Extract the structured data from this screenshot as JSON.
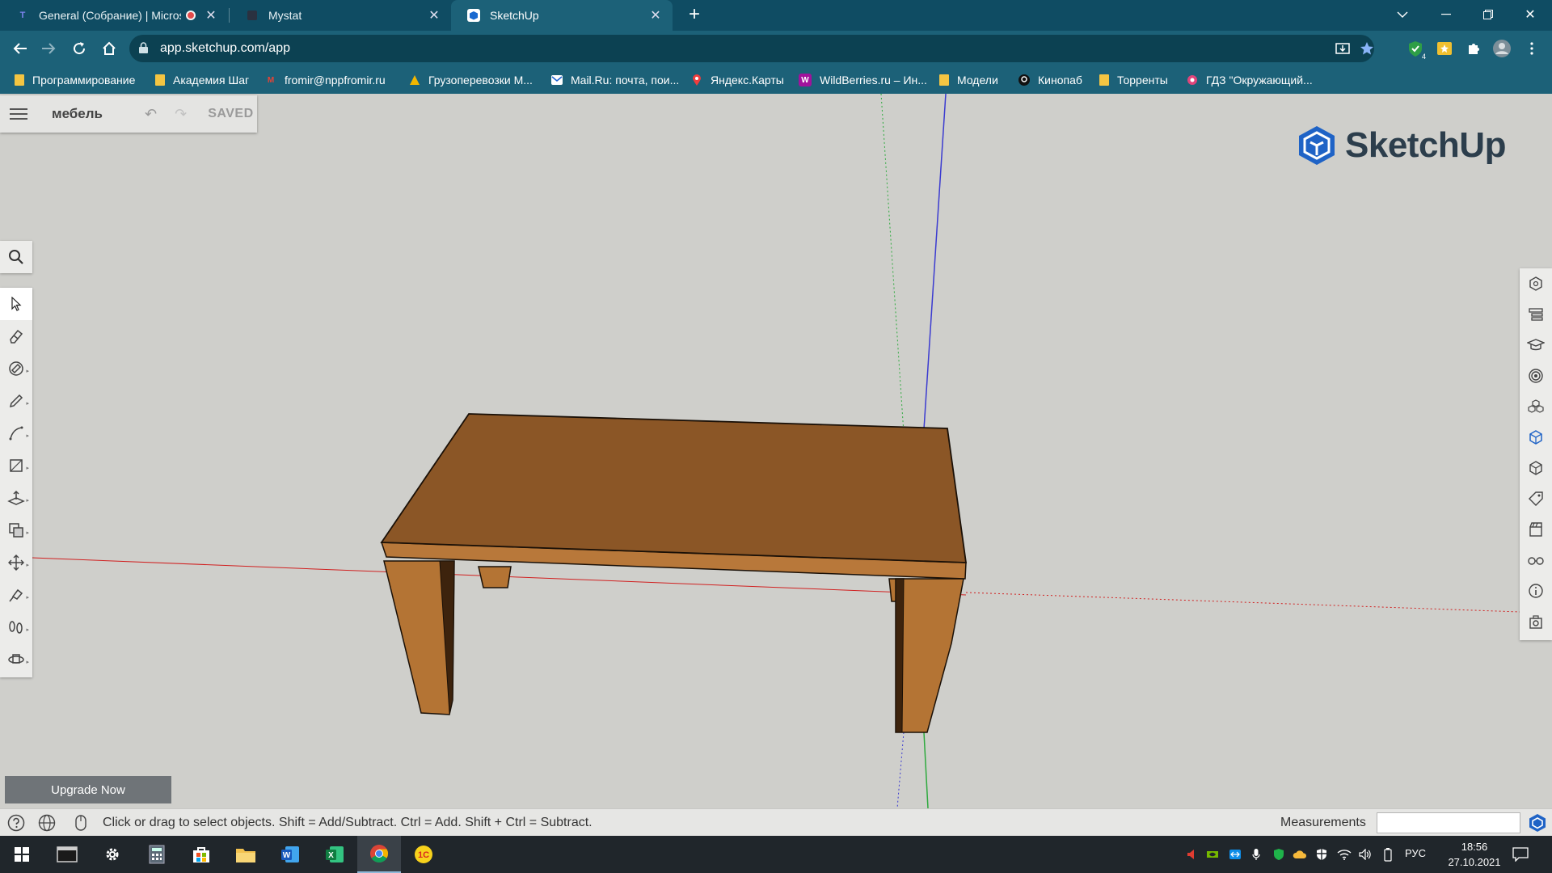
{
  "browser": {
    "tabs": [
      {
        "title": "General (Собрание) | Micros",
        "icon": "teams-icon",
        "active": false
      },
      {
        "title": "Mystat",
        "icon": "mystat-icon",
        "active": false
      },
      {
        "title": "SketchUp",
        "icon": "sketchup-icon",
        "active": true
      }
    ],
    "new_tab": "+",
    "url": "app.sketchup.com/app",
    "bookmarks": [
      {
        "label": "Программирование",
        "icon": "folder-icon"
      },
      {
        "label": "Академия Шаг",
        "icon": "folder-icon"
      },
      {
        "label": "fromir@nppfromir.ru",
        "icon": "gmail-icon"
      },
      {
        "label": "Грузоперевозки М...",
        "icon": "truck-logo-icon"
      },
      {
        "label": "Mail.Ru: почта, пои...",
        "icon": "mail-icon"
      },
      {
        "label": "Яндекс.Карты",
        "icon": "map-pin-icon"
      },
      {
        "label": "WildBerries.ru – Ин...",
        "icon": "wildberries-icon"
      },
      {
        "label": "Модели",
        "icon": "folder-icon"
      },
      {
        "label": "Кинопаб",
        "icon": "kinopub-icon"
      },
      {
        "label": "Торренты",
        "icon": "folder-icon"
      },
      {
        "label": "ГДЗ \"Окружающий...",
        "icon": "gdz-icon"
      }
    ],
    "extension_badge": "4"
  },
  "app": {
    "file_name": "мебель",
    "save_status": "SAVED",
    "brand": "SketchUp",
    "upgrade_label": "Upgrade Now",
    "status_hint": "Click or drag to select objects. Shift = Add/Subtract. Ctrl = Add. Shift + Ctrl = Subtract.",
    "measurements_label": "Measurements",
    "measurements_value": "",
    "selected_tool": "select",
    "left_tools": [
      "select-icon",
      "eraser-icon",
      "paint-bucket-icon",
      "pencil-icon",
      "arc-icon",
      "rectangle-icon",
      "push-pull-icon",
      "offset-icon",
      "move-icon",
      "tape-measure-icon",
      "walk-icon",
      "orbit-icon"
    ],
    "right_panels": [
      "entity-info-icon",
      "outliner-icon",
      "instructor-icon",
      "materials-icon",
      "components-icon",
      "styles-icon",
      "scenes-3d-icon",
      "tags-icon",
      "scenes-icon",
      "display-icon",
      "model-info-icon",
      "export-icon"
    ]
  },
  "taskbar": {
    "language": "РУС",
    "time": "18:56",
    "date": "27.10.2021",
    "apps": [
      "windows-start-icon",
      "terminal-icon",
      "settings-icon",
      "calculator-icon",
      "store-icon",
      "file-explorer-icon",
      "word-icon",
      "excel-icon",
      "chrome-icon",
      "1c-icon"
    ],
    "active_app": "chrome-icon"
  },
  "colors": {
    "browser_frame": "#0f4c63",
    "browser_toolbar": "#1c6178",
    "viewport_bg": "#cfcfcb",
    "table_top": "#8b5626",
    "table_side": "#b47434",
    "axis_red": "#d02020",
    "axis_green": "#2eaa3e",
    "axis_blue": "#3b3bd0"
  }
}
